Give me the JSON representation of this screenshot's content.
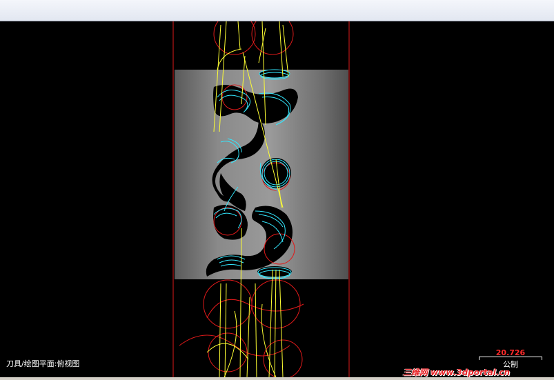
{
  "status_bar": {
    "view_label": "刀具/绘图平面:俯视图"
  },
  "scale": {
    "value": "20.726",
    "unit": "公制"
  },
  "watermark": {
    "text": "三维网 www.3dportal.cn"
  },
  "colors": {
    "background": "#000000",
    "boundary": "#e01a1a",
    "toolpath_yellow": "#ffff33",
    "toolpath_cyan": "#33e8ff",
    "part_gray": "#808080"
  }
}
